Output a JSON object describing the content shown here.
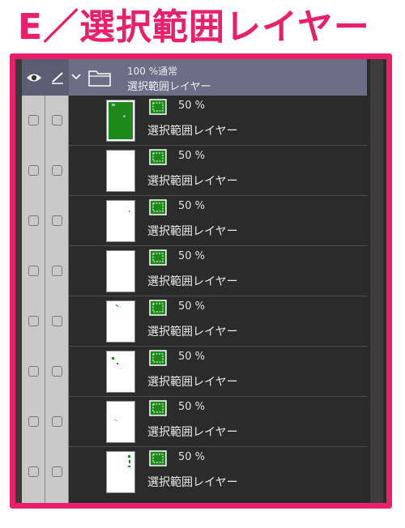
{
  "heading": "E／選択範囲レイヤー",
  "colors": {
    "accent": "#ea1f6a",
    "selection_green": "#1e8a1e"
  },
  "panel": {
    "header_icons": [
      "eye-icon",
      "pen-icon"
    ],
    "folder": {
      "blend": "100 %通常",
      "name": "選択範囲レイヤー",
      "expanded": true
    },
    "layers": [
      {
        "opacity": "50 %",
        "name": "選択範囲レイヤー",
        "thumb": "full"
      },
      {
        "opacity": "50 %",
        "name": "選択範囲レイヤー",
        "thumb": "blank"
      },
      {
        "opacity": "50 %",
        "name": "選択範囲レイヤー",
        "thumb": "blank"
      },
      {
        "opacity": "50 %",
        "name": "選択範囲レイヤー",
        "thumb": "blank"
      },
      {
        "opacity": "50 %",
        "name": "選択範囲レイヤー",
        "thumb": "speck"
      },
      {
        "opacity": "50 %",
        "name": "選択範囲レイヤー",
        "thumb": "dots"
      },
      {
        "opacity": "50 %",
        "name": "選択範囲レイヤー",
        "thumb": "faint"
      },
      {
        "opacity": "50 %",
        "name": "選択範囲レイヤー",
        "thumb": "side"
      }
    ]
  }
}
